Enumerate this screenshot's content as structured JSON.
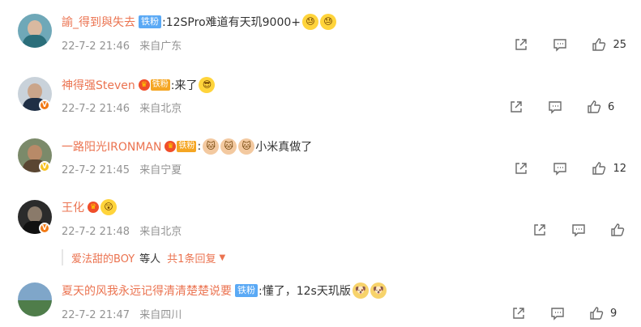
{
  "colors": {
    "username": "#eb7350",
    "meta": "#939393",
    "fan_badge": "#5aa9f5",
    "vip_fan": "#f5a623"
  },
  "comments": [
    {
      "username": "諭_得到與失去",
      "badge": "铁粉",
      "text": ":12SPro难道有天玑9000+",
      "emojis": [
        "cold-sweat-emoji",
        "cold-sweat-emoji"
      ],
      "date": "22-7-2 21:46",
      "location": "来自广东",
      "likes": "25"
    },
    {
      "username": "神得强Steven",
      "badge": "铁粉",
      "text": ":来了",
      "emojis": [
        "sunglasses-emoji"
      ],
      "date": "22-7-2 21:46",
      "location": "来自北京",
      "likes": "6"
    },
    {
      "username": "一路阳光IRONMAN",
      "badge": "铁粉",
      "text": "小米真做了",
      "emojis": [
        "cat-emoji",
        "cat-emoji",
        "cat-emoji"
      ],
      "date": "22-7-2 21:45",
      "location": "来自宁夏",
      "likes": "12"
    },
    {
      "username": "王化",
      "badge": "",
      "text": "",
      "emojis": [
        "surprised-emoji"
      ],
      "date": "22-7-2 21:48",
      "location": "来自北京",
      "likes": ""
    },
    {
      "username": "夏天的风我永远记得清清楚楚说要",
      "badge": "铁粉",
      "text": ":懂了，12s天玑版",
      "emojis": [
        "doge-emoji",
        "doge-emoji"
      ],
      "date": "22-7-2 21:47",
      "location": "来自四川",
      "likes": "9"
    }
  ],
  "reply_bar": {
    "name": "爱法甜的BOY",
    "middle": "等人",
    "count": "共1条回复"
  }
}
